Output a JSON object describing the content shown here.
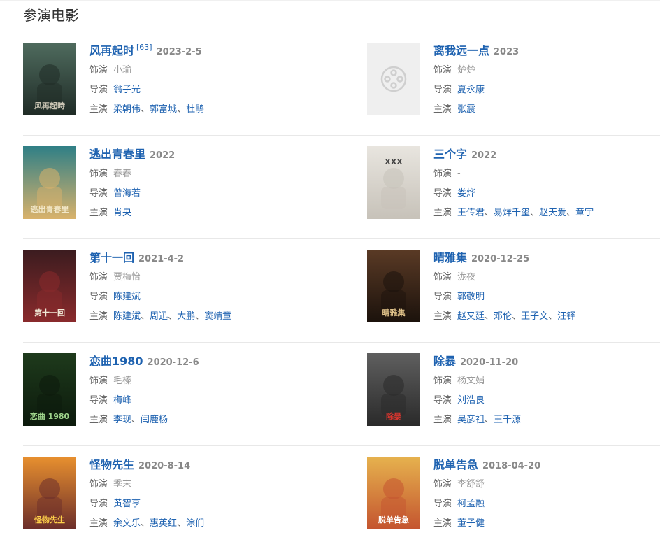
{
  "section_title": "参演电影",
  "labels": {
    "role": "饰演",
    "director": "导演",
    "cast": "主演"
  },
  "films": [
    {
      "title": "风再起时",
      "sup": "[63]",
      "date": "2023-2-5",
      "role": "小瑜",
      "director": [
        "翁子光"
      ],
      "cast": [
        "梁朝伟",
        "郭富城",
        "杜鹃"
      ],
      "poster_theme": "dark-green",
      "poster_text": "风再起時"
    },
    {
      "title": "离我远一点",
      "sup": "",
      "date": "2023",
      "role": "楚楚",
      "director": [
        "夏永康"
      ],
      "cast": [
        "张震"
      ],
      "poster_theme": "placeholder",
      "poster_text": ""
    },
    {
      "title": "逃出青春里",
      "sup": "",
      "date": "2022",
      "role": "春春",
      "director": [
        "曾海若"
      ],
      "cast": [
        "肖央"
      ],
      "poster_theme": "teal",
      "poster_text": "逃出青春里"
    },
    {
      "title": "三个字",
      "sup": "",
      "date": "2022",
      "role": "-",
      "director": [
        "娄烨"
      ],
      "cast": [
        "王传君",
        "易烊千玺",
        "赵天爱",
        "章宇"
      ],
      "poster_theme": "paper",
      "poster_text": "XXX"
    },
    {
      "title": "第十一回",
      "sup": "",
      "date": "2021-4-2",
      "role": "贾梅怡",
      "director": [
        "陈建斌"
      ],
      "cast": [
        "陈建斌",
        "周迅",
        "大鹏",
        "窦靖童"
      ],
      "poster_theme": "red-grid",
      "poster_text": "第十一回"
    },
    {
      "title": "晴雅集",
      "sup": "",
      "date": "2020-12-25",
      "role": "泷夜",
      "director": [
        "郭敬明"
      ],
      "cast": [
        "赵又廷",
        "邓伦",
        "王子文",
        "汪铎"
      ],
      "poster_theme": "brown",
      "poster_text": "晴雅集"
    },
    {
      "title": "恋曲1980",
      "sup": "",
      "date": "2020-12-6",
      "role": "毛榛",
      "director": [
        "梅峰"
      ],
      "cast": [
        "李现",
        "闫鹿杨"
      ],
      "poster_theme": "forest",
      "poster_text": "恋曲 1980"
    },
    {
      "title": "除暴",
      "sup": "",
      "date": "2020-11-20",
      "role": "杨文娟",
      "director": [
        "刘浩良"
      ],
      "cast": [
        "吴彦祖",
        "王千源"
      ],
      "poster_theme": "grey-red",
      "poster_text": "除暴"
    },
    {
      "title": "怪物先生",
      "sup": "",
      "date": "2020-8-14",
      "role": "季末",
      "director": [
        "黄智亨"
      ],
      "cast": [
        "余文乐",
        "惠英红",
        "涂们"
      ],
      "poster_theme": "orange",
      "poster_text": "怪物先生"
    },
    {
      "title": "脱单告急",
      "sup": "",
      "date": "2018-04-20",
      "role": "李舒舒",
      "director": [
        "柯孟融"
      ],
      "cast": [
        "董子健"
      ],
      "poster_theme": "warm",
      "poster_text": "脱单告急"
    }
  ]
}
